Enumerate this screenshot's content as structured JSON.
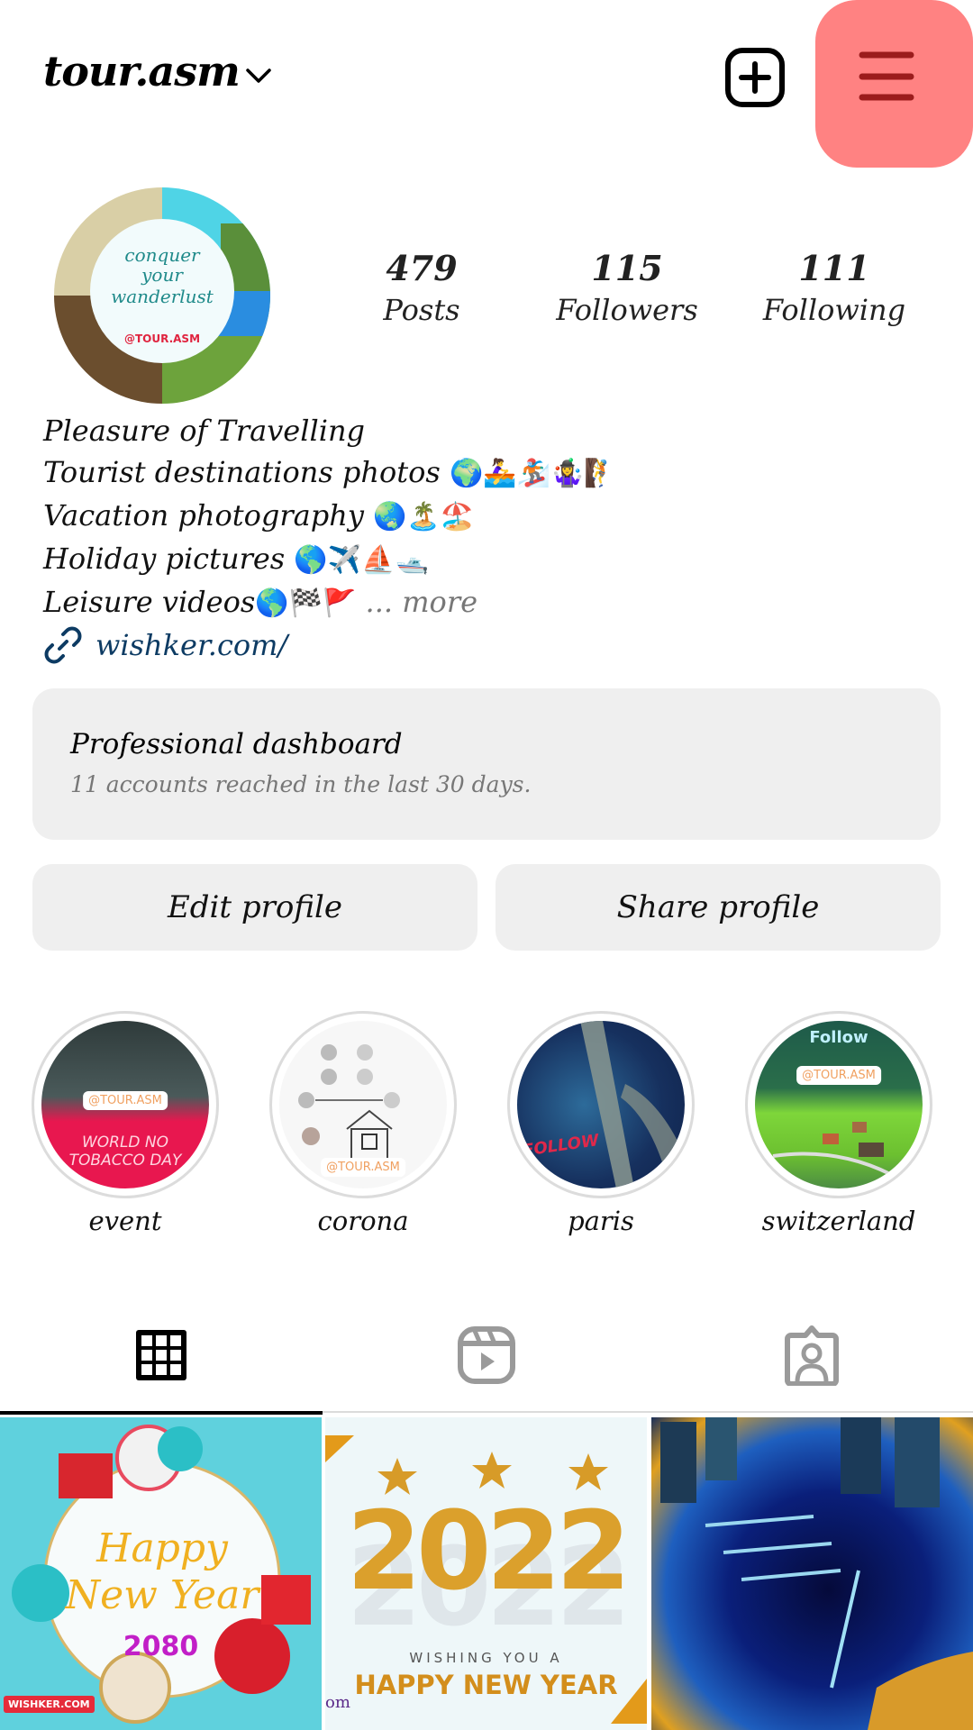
{
  "header": {
    "username": "tour.asm",
    "icons": {
      "dropdown": "chevron-down-icon",
      "create": "plus-square-icon",
      "menu": "hamburger-menu-icon"
    },
    "menu_highlight_color": "#ff8282",
    "menu_icon_color": "#9b1c1c"
  },
  "profile": {
    "avatar": {
      "line1": "conquer",
      "line2": "your",
      "line3": "wanderlust",
      "handle": "@TOUR.ASM"
    },
    "stats": [
      {
        "value": "479",
        "label": "Posts"
      },
      {
        "value": "115",
        "label": "Followers"
      },
      {
        "value": "111",
        "label": "Following"
      }
    ]
  },
  "bio": {
    "lines": [
      {
        "text": "Pleasure of Travelling",
        "emoji": ""
      },
      {
        "text": "Tourist destinations photos ",
        "emoji": "🌍🚣‍♀️🏂🤹‍♀️🧗"
      },
      {
        "text": "Vacation photography ",
        "emoji": "🌏🏝️🏖️"
      },
      {
        "text": "Holiday pictures ",
        "emoji": "🌎✈️⛵🛥️"
      },
      {
        "text": "Leisure videos",
        "emoji": "🌎🏁🚩"
      }
    ],
    "more_label": "... more",
    "link": "wishker.com/",
    "link_color": "#0d3b63"
  },
  "dashboard": {
    "title": "Professional dashboard",
    "subtitle": "11 accounts reached in the last 30 days."
  },
  "buttons": {
    "edit_profile": "Edit profile",
    "share_profile": "Share profile"
  },
  "highlights": [
    {
      "label": "event",
      "tag": "@TOUR.ASM",
      "caption": "WORLD NO TOBACCO DAY"
    },
    {
      "label": "corona",
      "tag": "@TOUR.ASM"
    },
    {
      "label": "paris",
      "caption": "FOLLOW"
    },
    {
      "label": "switzerland",
      "tag": "@TOUR.ASM",
      "caption": "Follow"
    }
  ],
  "tabs": [
    {
      "name": "posts-grid",
      "icon": "grid-icon",
      "active": true
    },
    {
      "name": "reels",
      "icon": "reels-icon",
      "active": false
    },
    {
      "name": "tagged",
      "icon": "tagged-person-icon",
      "active": false
    }
  ],
  "posts": [
    {
      "title": "Happy New Year",
      "year": "2080",
      "watermark": "WISHKER.COM"
    },
    {
      "year": "2022",
      "line1": "WISHING YOU A",
      "line2": "HAPPY NEW YEAR",
      "edge_text": "om"
    },
    {
      "description": "Night city marina aerial view"
    }
  ]
}
